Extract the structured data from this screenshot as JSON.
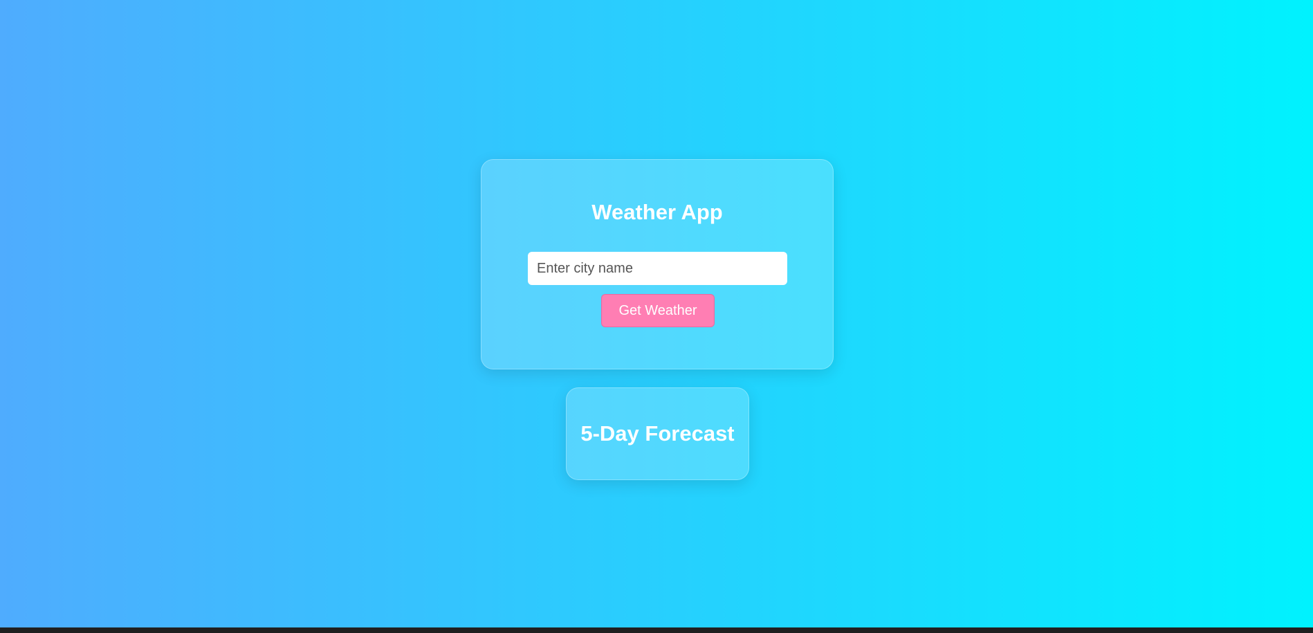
{
  "app": {
    "title": "Weather App",
    "search": {
      "placeholder": "Enter city name",
      "value": ""
    },
    "get_weather_label": "Get Weather"
  },
  "forecast": {
    "title": "5-Day Forecast"
  },
  "colors": {
    "background_start": "#4facfe",
    "background_end": "#00f2fe",
    "button": "#ff7eb3",
    "text": "#ffffff"
  }
}
